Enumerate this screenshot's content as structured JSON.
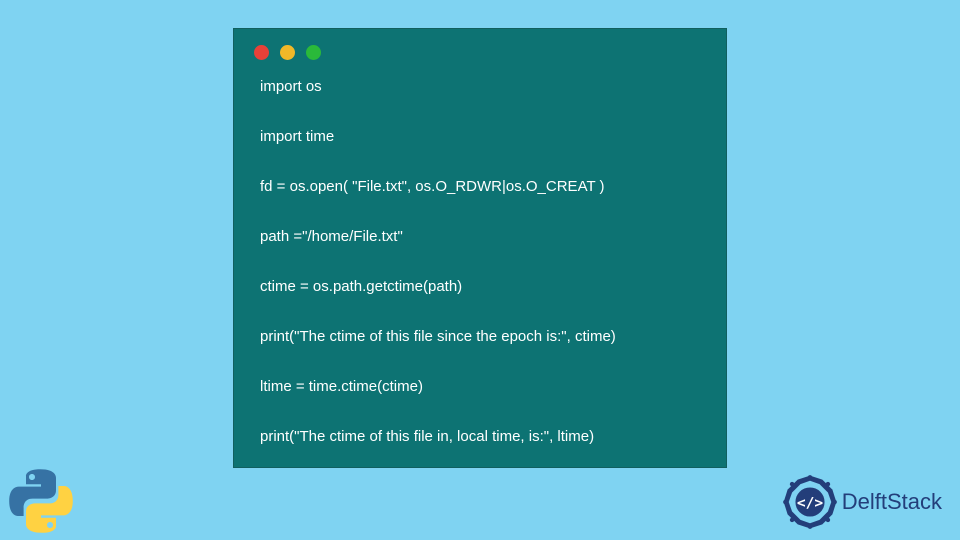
{
  "code": {
    "lines": [
      "import os",
      "import time",
      "fd = os.open( \"File.txt\", os.O_RDWR|os.O_CREAT )",
      "path =\"/home/File.txt\"",
      "ctime = os.path.getctime(path)",
      "print(\"The ctime of this file since the epoch is:\", ctime)",
      "ltime = time.ctime(ctime)",
      "print(\"The ctime of this file in, local time, is:\", ltime)"
    ]
  },
  "branding": {
    "site_name": "DelftStack"
  },
  "colors": {
    "background": "#7fd3f2",
    "code_bg": "#0d7373",
    "code_text": "#ffffff",
    "dot_red": "#e84138",
    "dot_yellow": "#f0b828",
    "dot_green": "#2ab93a",
    "brand_blue": "#233e7a"
  }
}
